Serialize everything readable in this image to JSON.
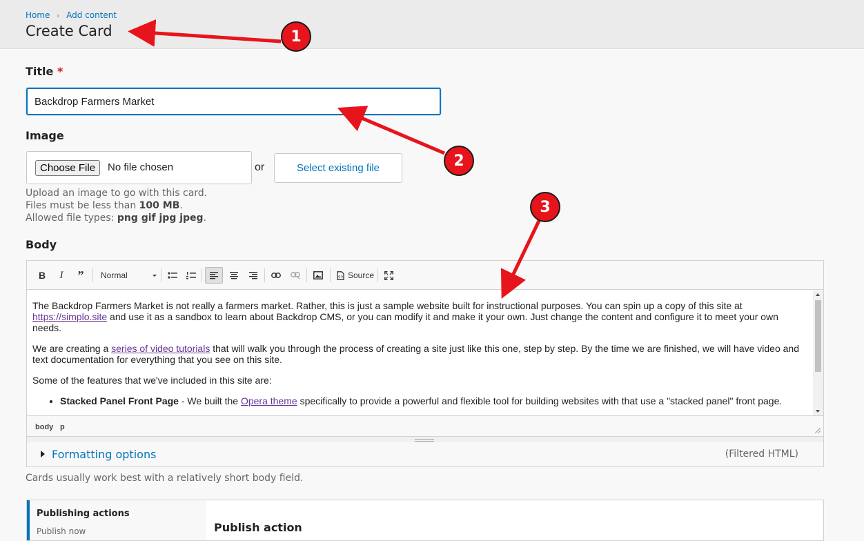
{
  "header": {
    "breadcrumb": [
      {
        "label": "Home"
      },
      {
        "label": "Add content"
      }
    ],
    "title": "Create Card"
  },
  "title_field": {
    "label": "Title",
    "required_marker": "*",
    "value": "Backdrop Farmers Market"
  },
  "image_field": {
    "label": "Image",
    "choose_file_label": "Choose File",
    "no_file_text": "No file chosen",
    "or_text": "or",
    "select_existing_label": "Select existing file",
    "help_line1": "Upload an image to go with this card.",
    "help_line2_prefix": "Files must be less than ",
    "help_line2_size": "100 MB",
    "help_line2_suffix": ".",
    "help_line3_prefix": "Allowed file types: ",
    "help_line3_types": "png gif jpg jpeg",
    "help_line3_suffix": "."
  },
  "body_field": {
    "label": "Body",
    "toolbar": {
      "format_value": "Normal",
      "source_label": "Source"
    },
    "content": {
      "p1_text1": "The Backdrop Farmers Market is not really a farmers market. Rather, this is just a sample website built for instructional purposes. You can spin up a copy of this site at ",
      "p1_link": "https://simplo.site",
      "p1_text2": " and use it as a sandbox to learn about Backdrop CMS, or you can modify it and make it your own. Just change the content and configure it to meet your own needs.",
      "p2_text1": "We are creating a ",
      "p2_link": "series of video tutorials",
      "p2_text2": " that will walk you through the process of creating a site just like this one, step by step. By the time we are finished, we will have video and text documentation for everything that you see on this site.",
      "p3_text": "Some of the features that we've included in this site are:",
      "li1_bold": "Stacked Panel Front Page",
      "li1_text1": " - We built the ",
      "li1_link": "Opera theme",
      "li1_text2": " specifically to provide a powerful and flexible tool for building websites with that use a \"stacked panel\" front page."
    },
    "path": [
      "body",
      "p"
    ],
    "formatting_label": "Formatting options",
    "filtered_label": "(Filtered HTML)",
    "help": "Cards usually work best with a relatively short body field."
  },
  "publishing": {
    "tab_title": "Publishing actions",
    "tab_sub": "Publish now",
    "action_heading": "Publish action"
  },
  "annotations": {
    "badge1": "1",
    "badge2": "2",
    "badge3": "3",
    "color": "#e8141b"
  },
  "colors": {
    "accent": "#0074bd",
    "link_visited": "#663399",
    "required": "#d3222a"
  }
}
